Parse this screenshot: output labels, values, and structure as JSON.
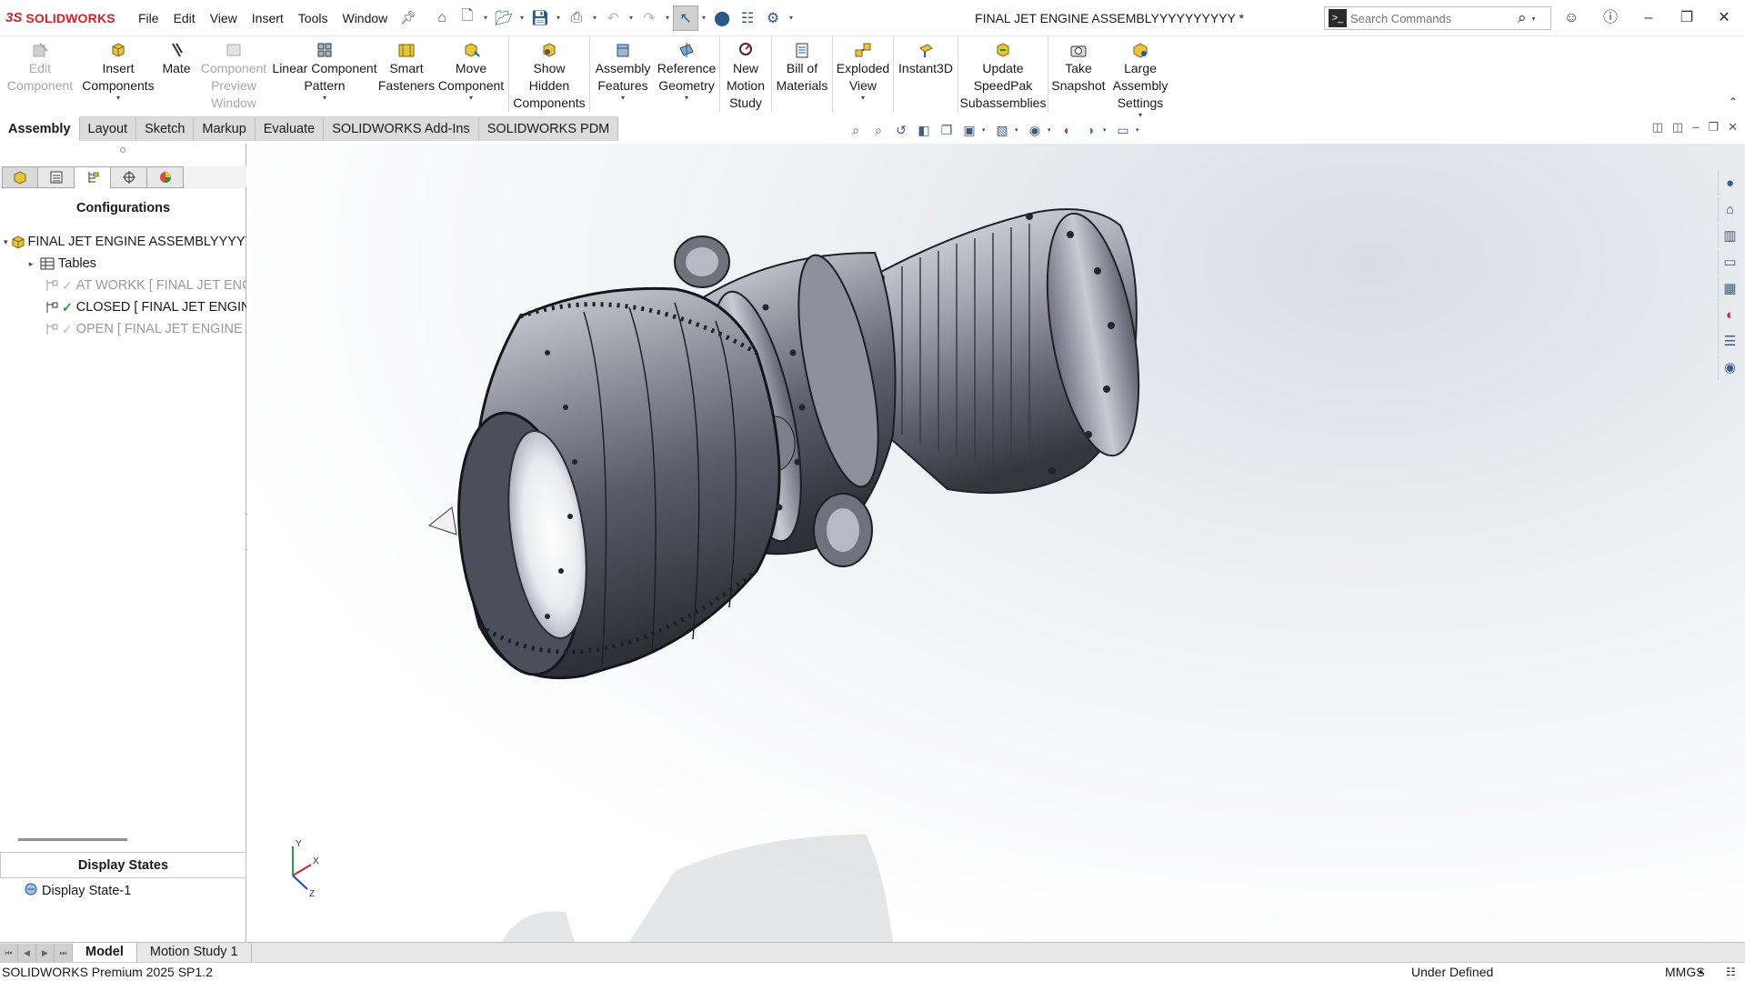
{
  "app": {
    "brand": "SOLIDWORKS",
    "document_title": "FINAL JET ENGINE ASSEMBLYYYYYYYYYY *"
  },
  "menu": [
    "File",
    "Edit",
    "View",
    "Insert",
    "Tools",
    "Window"
  ],
  "search": {
    "placeholder": "Search Commands"
  },
  "command_manager": [
    {
      "label": "Edit\nComponent",
      "enabled": false,
      "icon": "edit-component-icon"
    },
    {
      "label": "Insert\nComponents",
      "enabled": true,
      "dropdown": true,
      "icon": "insert-components-icon"
    },
    {
      "label": "Mate",
      "enabled": true,
      "icon": "mate-icon"
    },
    {
      "label": "Component\nPreview\nWindow",
      "enabled": false,
      "icon": "component-preview-icon"
    },
    {
      "label": "Linear Component\nPattern",
      "enabled": true,
      "dropdown": true,
      "icon": "linear-pattern-icon"
    },
    {
      "label": "Smart\nFasteners",
      "enabled": true,
      "icon": "smart-fasteners-icon"
    },
    {
      "label": "Move\nComponent",
      "enabled": true,
      "dropdown": true,
      "icon": "move-component-icon"
    },
    {
      "label": "Show\nHidden\nComponents",
      "enabled": true,
      "icon": "show-hidden-icon"
    },
    {
      "label": "Assembly\nFeatures",
      "enabled": true,
      "dropdown": true,
      "icon": "assembly-features-icon"
    },
    {
      "label": "Reference\nGeometry",
      "enabled": true,
      "dropdown": true,
      "icon": "reference-geometry-icon"
    },
    {
      "label": "New\nMotion\nStudy",
      "enabled": true,
      "icon": "motion-study-icon"
    },
    {
      "label": "Bill of\nMaterials",
      "enabled": true,
      "icon": "bom-icon"
    },
    {
      "label": "Exploded\nView",
      "enabled": true,
      "dropdown": true,
      "icon": "exploded-view-icon"
    },
    {
      "label": "Instant3D",
      "enabled": true,
      "icon": "instant3d-icon"
    },
    {
      "label": "Update\nSpeedPak\nSubassemblies",
      "enabled": true,
      "icon": "speedpak-icon"
    },
    {
      "label": "Take\nSnapshot",
      "enabled": true,
      "icon": "snapshot-icon"
    },
    {
      "label": "Large\nAssembly\nSettings",
      "enabled": true,
      "dropdown": true,
      "icon": "large-assembly-icon"
    }
  ],
  "tabs": [
    "Assembly",
    "Layout",
    "Sketch",
    "Markup",
    "Evaluate",
    "SOLIDWORKS Add-Ins",
    "SOLIDWORKS PDM"
  ],
  "active_tab": "Assembly",
  "configuration_manager": {
    "title": "Configurations",
    "root": "FINAL JET ENGINE ASSEMBLYYYYYYYYYYY",
    "tables": "Tables",
    "configs": [
      {
        "label": "AT WORKK [ FINAL JET ENGINE ASSEMBLYYYYYYYYYY ]",
        "active": false
      },
      {
        "label": "CLOSED [ FINAL JET ENGINE ASSEMBLYYYYYYYYYY ]",
        "active": true
      },
      {
        "label": "OPEN [ FINAL JET ENGINE ASSEMBLYYYYYYYYYY ]",
        "active": false
      }
    ],
    "display_states_title": "Display States",
    "display_state": "Display State-1"
  },
  "triad": {
    "x": "X",
    "y": "Y",
    "z": "Z"
  },
  "bottom_tabs": [
    "Model",
    "Motion Study 1"
  ],
  "active_bottom_tab": "Model",
  "status": {
    "product": "SOLIDWORKS Premium 2025 SP1.2",
    "state": "Under Defined",
    "units": "MMGS"
  },
  "colors": {
    "brand_red": "#d2232a",
    "accent_green": "#1e9a3a",
    "icon_blue": "#2a5a8a"
  }
}
